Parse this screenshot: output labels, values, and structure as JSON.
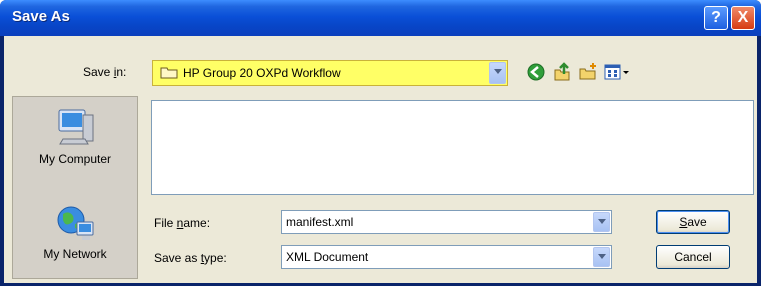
{
  "dialog": {
    "title": "Save As",
    "help_glyph": "?",
    "close_glyph": "X"
  },
  "save_in": {
    "label_prefix": "Save ",
    "label_key": "i",
    "label_suffix": "n:",
    "value": "HP Group 20 OXPd Workflow"
  },
  "toolbar": {
    "icons": [
      "back-icon",
      "up-folder-icon",
      "new-folder-icon",
      "views-menu-icon"
    ]
  },
  "places": [
    {
      "label": "My Computer",
      "icon": "my-computer-icon"
    },
    {
      "label": "My Network",
      "icon": "my-network-icon"
    }
  ],
  "file_name": {
    "label_prefix": "File ",
    "label_key": "n",
    "label_suffix": "ame:",
    "value": "manifest.xml"
  },
  "save_as_type": {
    "label_prefix": "Save as ",
    "label_key": "t",
    "label_suffix": "ype:",
    "value": "XML Document"
  },
  "buttons": {
    "save_key": "S",
    "save_rest": "ave",
    "cancel": "Cancel"
  },
  "colors": {
    "title_bar": "#0a50d8",
    "dialog_bg": "#ece9d8",
    "highlight": "#ffff66"
  }
}
